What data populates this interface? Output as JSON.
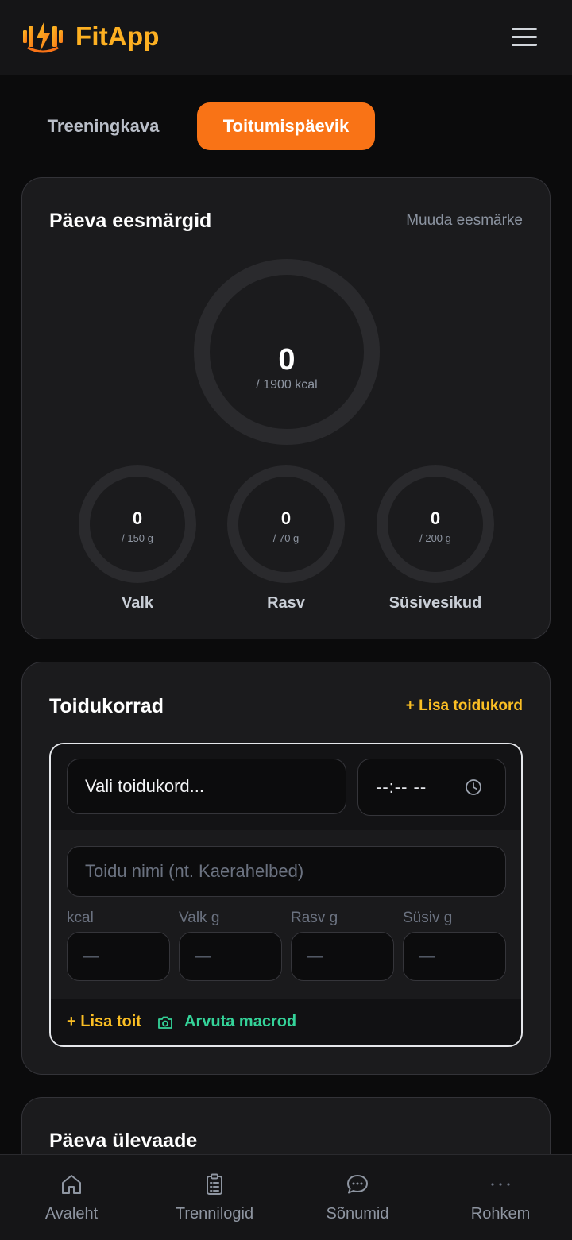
{
  "header": {
    "app_name": "FitApp",
    "brand_color": "#fdb022",
    "logo_icon": "dumbbell-bolt-icon",
    "menu_icon": "hamburger-menu-icon"
  },
  "tabs": [
    {
      "label": "Treeningkava",
      "active": false
    },
    {
      "label": "Toitumispäevik",
      "active": true
    }
  ],
  "accent_color": "#f97316",
  "goals": {
    "title": "Päeva eesmärgid",
    "edit_label": "Muuda eesmärke",
    "calories": {
      "value": "0",
      "target": "/ 1900 kcal",
      "progress": 0
    },
    "macros": [
      {
        "label": "Valk",
        "value": "0",
        "target": "/ 150 g",
        "progress": 0
      },
      {
        "label": "Rasv",
        "value": "0",
        "target": "/ 70 g",
        "progress": 0
      },
      {
        "label": "Süsivesikud",
        "value": "0",
        "target": "/ 200 g",
        "progress": 0
      }
    ]
  },
  "meals": {
    "title": "Toidukorrad",
    "add_meal_label": "+ Lisa toidukord",
    "meal_select_value": "Vali toidukord...",
    "time_value": "--:-- --",
    "food_name_placeholder": "Toidu nimi (nt. Kaerahelbed)",
    "fields": [
      {
        "label": "kcal",
        "value": "—"
      },
      {
        "label": "Valk g",
        "value": "—"
      },
      {
        "label": "Rasv g",
        "value": "—"
      },
      {
        "label": "Süsiv g",
        "value": "—"
      }
    ],
    "add_food_label": "+ Lisa toit",
    "calc_macros_label": "Arvuta macrod",
    "calc_icon": "camera-icon"
  },
  "summary": {
    "title": "Päeva ülevaade"
  },
  "bottom_nav": [
    {
      "label": "Avaleht",
      "icon": "home-icon"
    },
    {
      "label": "Trennilogid",
      "icon": "clipboard-icon"
    },
    {
      "label": "Sõnumid",
      "icon": "chat-icon"
    },
    {
      "label": "Rohkem",
      "icon": "more-dots-icon"
    }
  ]
}
